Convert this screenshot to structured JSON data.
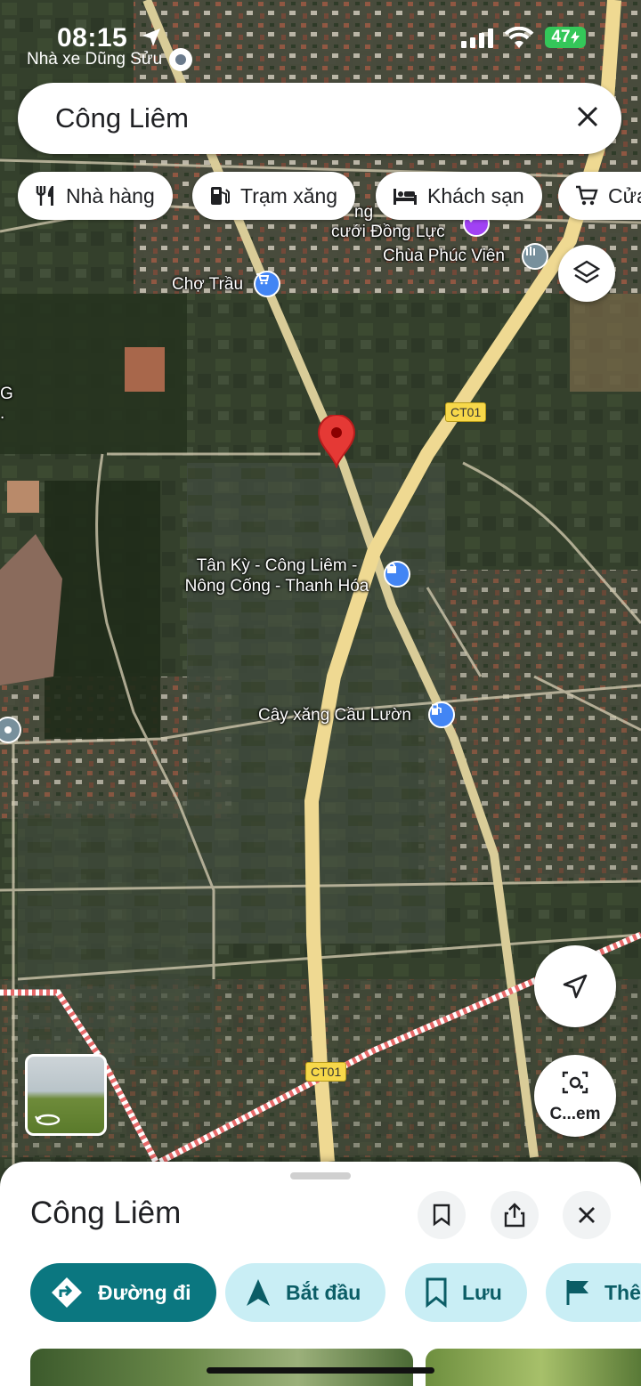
{
  "status_bar": {
    "time": "08:15",
    "back_app": "Nhà xe Dũng Sửu",
    "battery": "47"
  },
  "search": {
    "query": "Công Liêm",
    "clear_icon": "close-icon"
  },
  "chips": [
    {
      "label": "Nhà hàng",
      "icon": "restaurant-icon"
    },
    {
      "label": "Trạm xăng",
      "icon": "gas-station-icon"
    },
    {
      "label": "Khách sạn",
      "icon": "hotel-icon"
    },
    {
      "label": "Cửa",
      "icon": "shopping-cart-icon"
    }
  ],
  "map": {
    "labels": {
      "wedding_a": "ng",
      "wedding_b": "cưới Đồng Lực",
      "temple": "Chùa Phúc Viên",
      "market": "Chợ Trầu",
      "post_a": "Tân Kỳ - Công Liêm -",
      "post_b": "Nông Cống - Thanh Hóa",
      "gas": "Cây xăng Cầu Lườn",
      "edge_a": "G",
      "edge_b": "."
    },
    "route_shields": [
      "CT01",
      "CT01"
    ],
    "colors": {
      "pin": "#e53935",
      "road": "#e9d9a2",
      "highway": "#f2dd94",
      "boundary": "#e86a6a",
      "poi_blue": "#4285f4",
      "poi_purple": "#a142f4"
    }
  },
  "controls": {
    "layers_icon": "layers-icon",
    "my_location_icon": "navigation-arrow-icon",
    "lens_label": "C...em"
  },
  "sheet": {
    "title": "Công Liêm",
    "actions": [
      {
        "label": "Đường đi",
        "icon": "directions-icon"
      },
      {
        "label": "Bắt đầu",
        "icon": "navigation-icon"
      },
      {
        "label": "Lưu",
        "icon": "bookmark-icon"
      },
      {
        "label": "Thê",
        "icon": "flag-icon"
      }
    ]
  }
}
